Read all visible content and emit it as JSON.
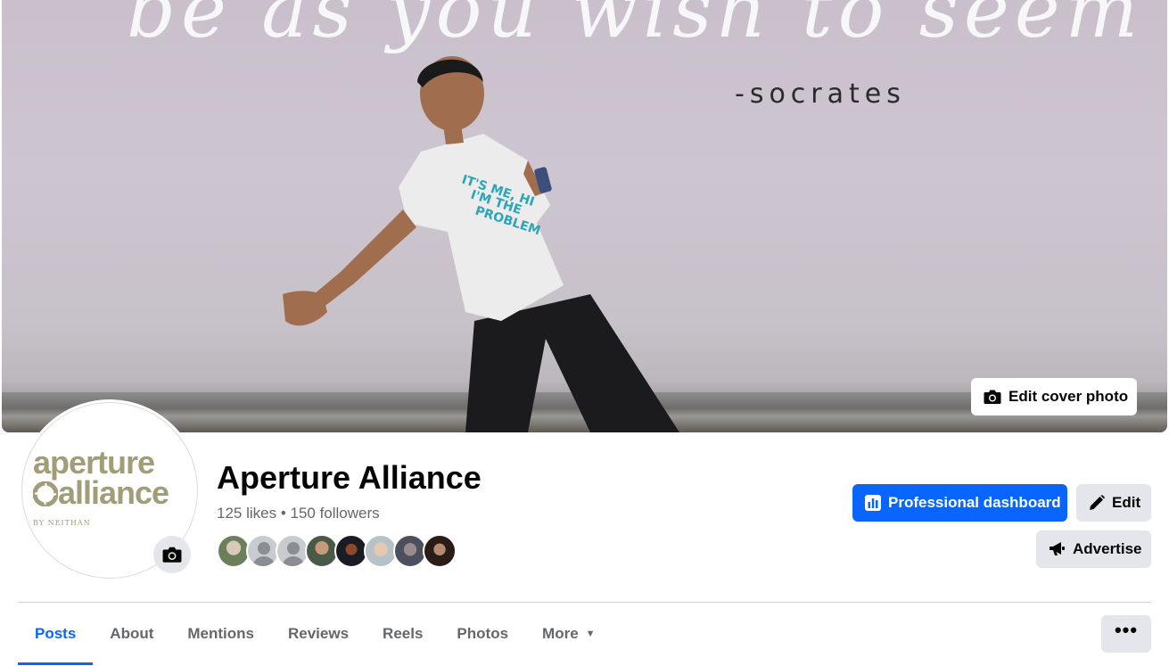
{
  "cover": {
    "quote_script": "be as you wish to seem",
    "quote_author": "-socrates",
    "edit_label": "Edit cover photo"
  },
  "avatar": {
    "logo_line1": "aperture",
    "logo_line2": "alliance",
    "logo_byline": "BY NEITHAN"
  },
  "page": {
    "name": "Aperture Alliance",
    "stats": "125 likes • 150 followers"
  },
  "actions": {
    "professional_dashboard": "Professional dashboard",
    "edit": "Edit",
    "advertise": "Advertise"
  },
  "tabs": [
    {
      "label": "Posts"
    },
    {
      "label": "About"
    },
    {
      "label": "Mentions"
    },
    {
      "label": "Reviews"
    },
    {
      "label": "Reels"
    },
    {
      "label": "Photos"
    },
    {
      "label": "More"
    }
  ],
  "more_button": "•••",
  "colors": {
    "accent": "#0866ff",
    "secondary_button": "#e4e6eb",
    "muted_text": "#65676b",
    "logo_olive": "#a09d78"
  }
}
